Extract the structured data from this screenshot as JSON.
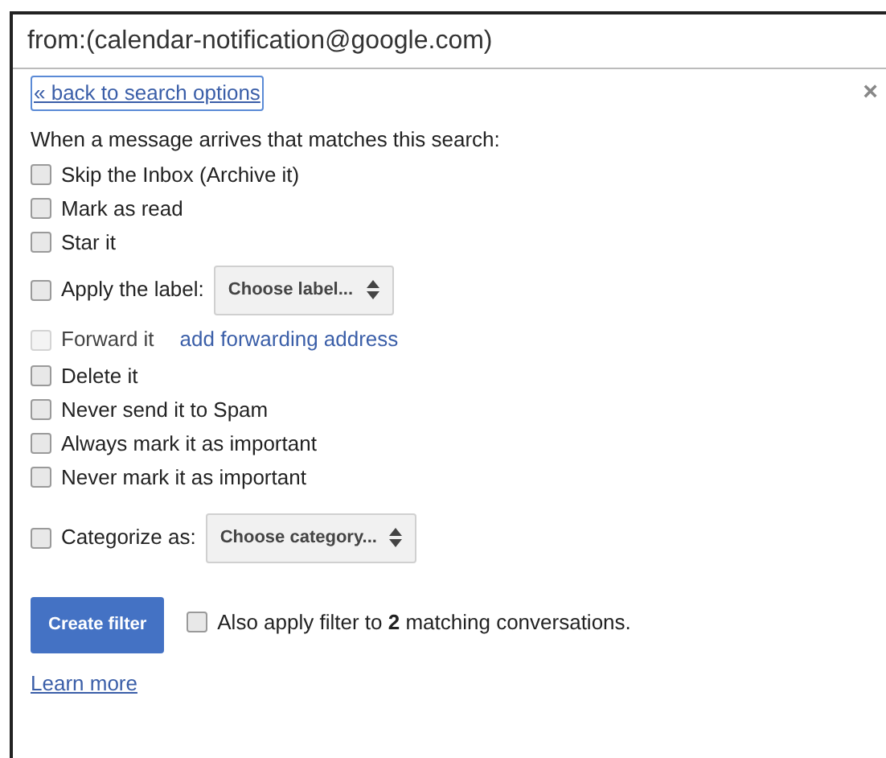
{
  "search": {
    "value": "from:(calendar-notification@google.com)"
  },
  "back_link": "« back to search options",
  "close": "×",
  "intro": "When a message arrives that matches this search:",
  "options": [
    {
      "kind": "plain",
      "label": "Skip the Inbox (Archive it)",
      "checked": false,
      "disabled": false
    },
    {
      "kind": "plain",
      "label": "Mark as read",
      "checked": false,
      "disabled": false
    },
    {
      "kind": "plain",
      "label": "Star it",
      "checked": false,
      "disabled": false
    },
    {
      "kind": "select",
      "label": "Apply the label:",
      "select": "Choose label...",
      "checked": false,
      "disabled": false
    },
    {
      "kind": "link",
      "label": "Forward it",
      "link": "add forwarding address",
      "checked": false,
      "disabled": true
    },
    {
      "kind": "plain",
      "label": "Delete it",
      "checked": false,
      "disabled": false
    },
    {
      "kind": "plain",
      "label": "Never send it to Spam",
      "checked": false,
      "disabled": false
    },
    {
      "kind": "plain",
      "label": "Always mark it as important",
      "checked": false,
      "disabled": false
    },
    {
      "kind": "plain",
      "label": "Never mark it as important",
      "checked": false,
      "disabled": false
    },
    {
      "kind": "select",
      "label": "Categorize as:",
      "select": "Choose category...",
      "checked": false,
      "disabled": false
    }
  ],
  "create_button": "Create filter",
  "also_apply": {
    "text": "Also apply filter to **2** matching conversations.",
    "checked": false
  },
  "learn_more": "Learn more"
}
